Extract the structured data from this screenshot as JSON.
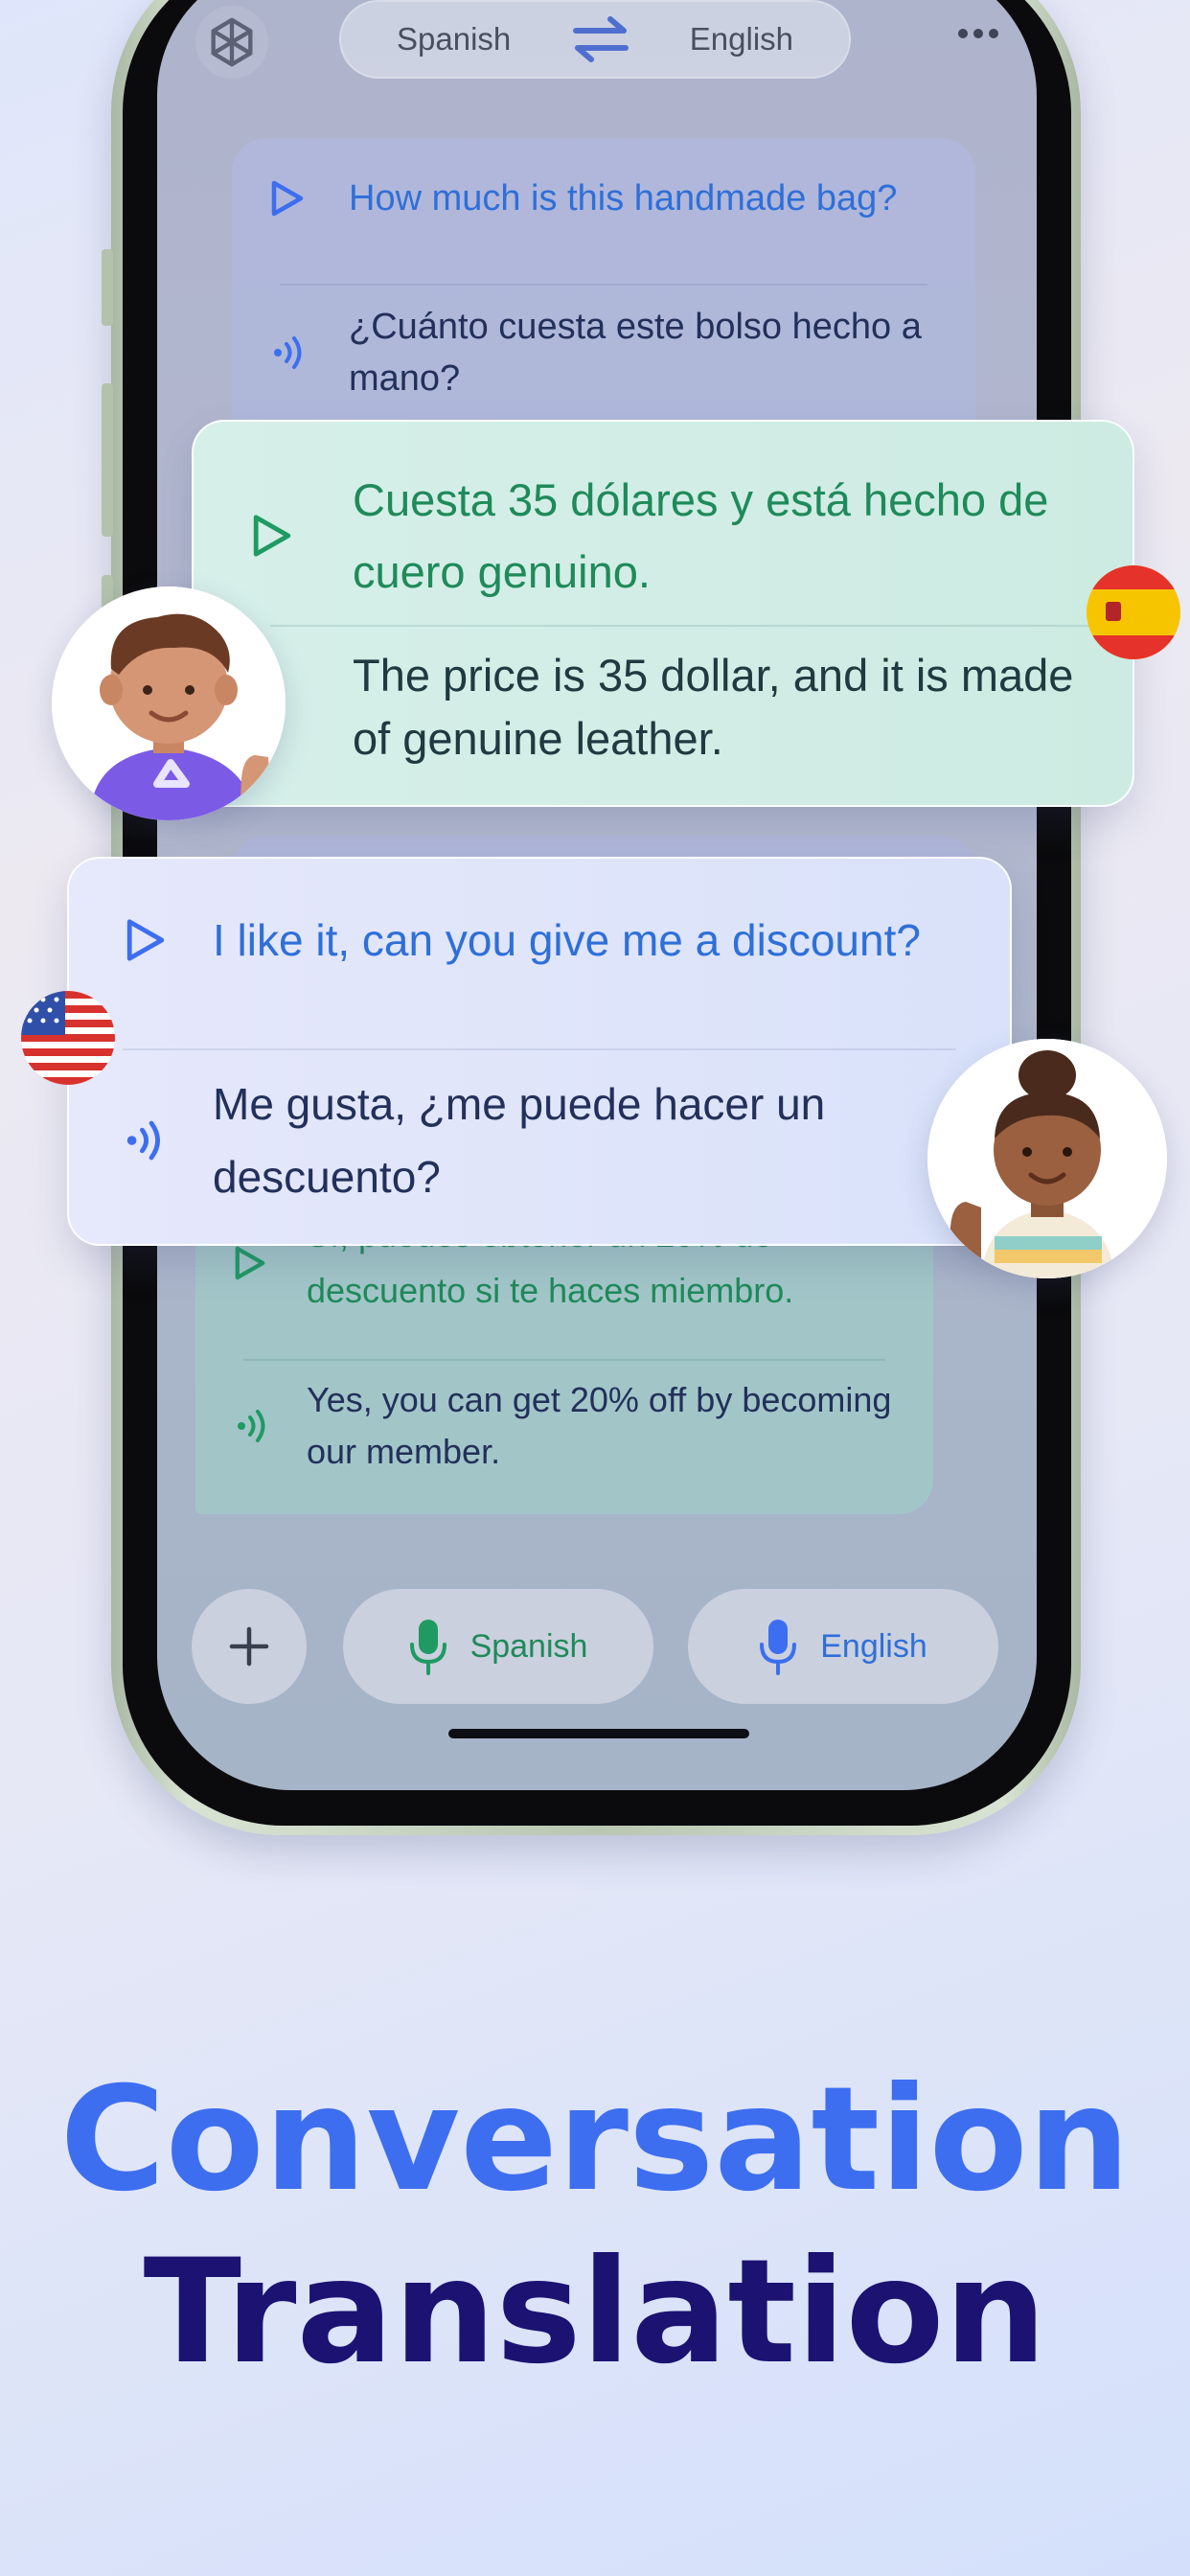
{
  "top_bar": {
    "source_language": "Spanish",
    "target_language": "English"
  },
  "conversation": [
    {
      "original": "How much is this handmade bag?",
      "translation": "¿Cuánto cuesta este bolso hecho a mano?"
    },
    {
      "original": "Cuesta 35 dólares y está hecho de cuero genuino.",
      "translation": "The price is 35 dollar, and it is made of genuine leather."
    },
    {
      "original": "I like it, can you give me a discount?",
      "translation": "Me gusta, ¿me puede hacer un descuento?"
    },
    {
      "original": "Sí, puedes obtener un 20% de descuento si te haces miembro.",
      "translation": "Yes, you can get 20% off by becoming our member."
    }
  ],
  "bottom_bar": {
    "spanish_mic_label": "Spanish",
    "english_mic_label": "English"
  },
  "headline": {
    "line1": "Conversation",
    "line2": "Translation"
  },
  "colors": {
    "accent_blue": "#3d6ef0",
    "headline_dark": "#1b1272",
    "spanish_green": "#1f8a5a",
    "english_blue": "#2f6fd8",
    "green_card": "#d3eee6",
    "blue_card": "#dde3f7"
  },
  "icons": {
    "app_logo": "openai-logo-icon",
    "swap": "swap-arrows-icon",
    "more": "more-dots-icon",
    "play": "play-icon",
    "speaker": "speaker-wave-icon",
    "add": "plus-icon",
    "mic": "microphone-icon"
  }
}
